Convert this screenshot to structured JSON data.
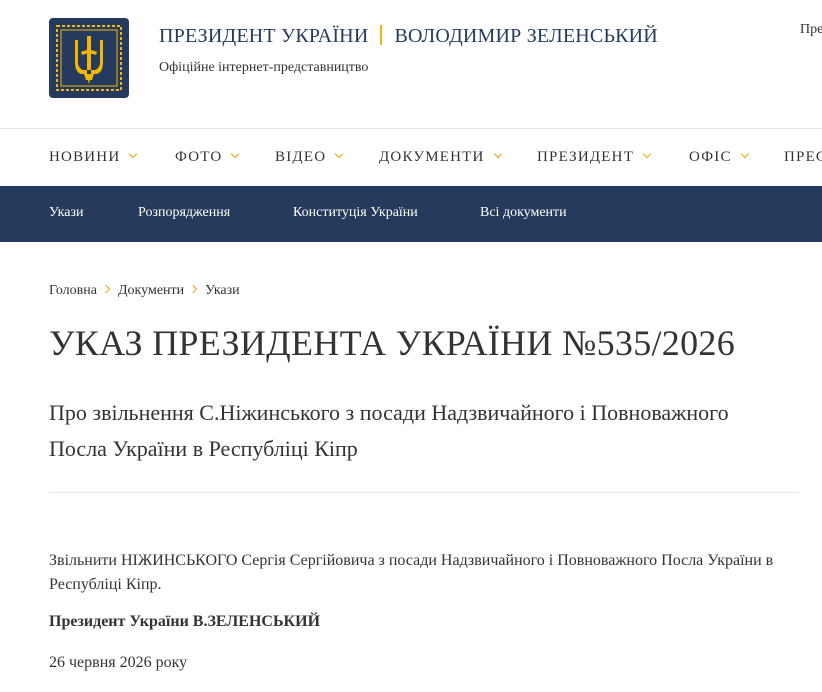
{
  "header": {
    "title_left": "ПРЕЗИДЕНТ УКРАЇНИ",
    "title_right": "ВОЛОДИМИР ЗЕЛЕНСЬКИЙ",
    "subtitle": "Офіційне інтернет-представництво",
    "right_text": "Пре",
    "logo_icon": "trident-icon",
    "colors": {
      "brand": "#253a5c",
      "accent": "#f2b705"
    }
  },
  "topnav": {
    "items": [
      {
        "label": "НОВИНИ"
      },
      {
        "label": "ФОТО"
      },
      {
        "label": "ВІДЕО"
      },
      {
        "label": "ДОКУМЕНТИ"
      },
      {
        "label": "ПРЕЗИДЕНТ"
      },
      {
        "label": "ОФІС"
      },
      {
        "label": "ПРЕС"
      }
    ]
  },
  "subnav": {
    "items": [
      {
        "label": "Укази"
      },
      {
        "label": "Розпорядження"
      },
      {
        "label": "Конституція України"
      },
      {
        "label": "Всі документи"
      }
    ]
  },
  "breadcrumb": {
    "items": [
      {
        "label": "Головна"
      },
      {
        "label": "Документи"
      },
      {
        "label": "Укази"
      }
    ]
  },
  "article": {
    "title": "УКАЗ ПРЕЗИДЕНТА УКРАЇНИ №535/2026",
    "subtitle": "Про звільнення С.Ніжинського з посади Надзвичайного і Повноважного Посла України в Республіці Кіпр",
    "body": "Звільнити НІЖИНСЬКОГО Сергія Сергійовича з посади Надзвичайного і Повноважного Посла України в Республіці Кіпр.",
    "signature": "Президент України В.ЗЕЛЕНСЬКИЙ",
    "date": "26 червня 2026 року"
  }
}
